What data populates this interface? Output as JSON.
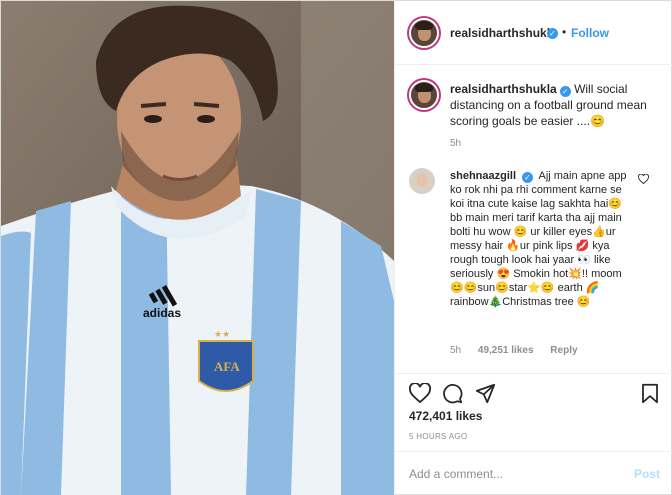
{
  "colors": {
    "link": "#3897f0",
    "text": "#262626",
    "muted": "#8e8e8e",
    "post_disabled": "#b2dffc",
    "verified": "#3897f0"
  },
  "photo": {
    "shirt_logo": "adidas",
    "badge_text": "AFA"
  },
  "header": {
    "username": "realsidharthshukla",
    "separator": "•",
    "follow_label": "Follow"
  },
  "caption": {
    "username": "realsidharthshukla",
    "text": "Will social distancing on a football ground mean scoring goals be easier ....😊",
    "time": "5h"
  },
  "comment": {
    "username": "shehnaazgill",
    "text": "Ajj main apne app ko rok nhi pa rhi comment karne se koi itna cute kaise lag sakhta hai😊 bb main meri tarif karta tha ajj main bolti hu wow 😊 ur killer eyes👍ur messy hair 🔥ur pink lips 💋 kya rough tough look hai yaar 👀 like seriously 😍 Smokin hot💥!! moom 😊😊sun😊star⭐😊 earth 🌈rainbow🎄Christmas tree 😊",
    "time": "5h",
    "likes": "49,251 likes",
    "reply_label": "Reply"
  },
  "post_stats": {
    "likes": "472,401 likes",
    "timestamp": "5 HOURS AGO"
  },
  "add_comment": {
    "placeholder": "Add a comment...",
    "post_label": "Post"
  },
  "icons": [
    "more-options-icon",
    "heart-icon",
    "comment-icon",
    "share-icon",
    "bookmark-icon",
    "comment-like-heart-icon",
    "verified-badge-icon"
  ]
}
